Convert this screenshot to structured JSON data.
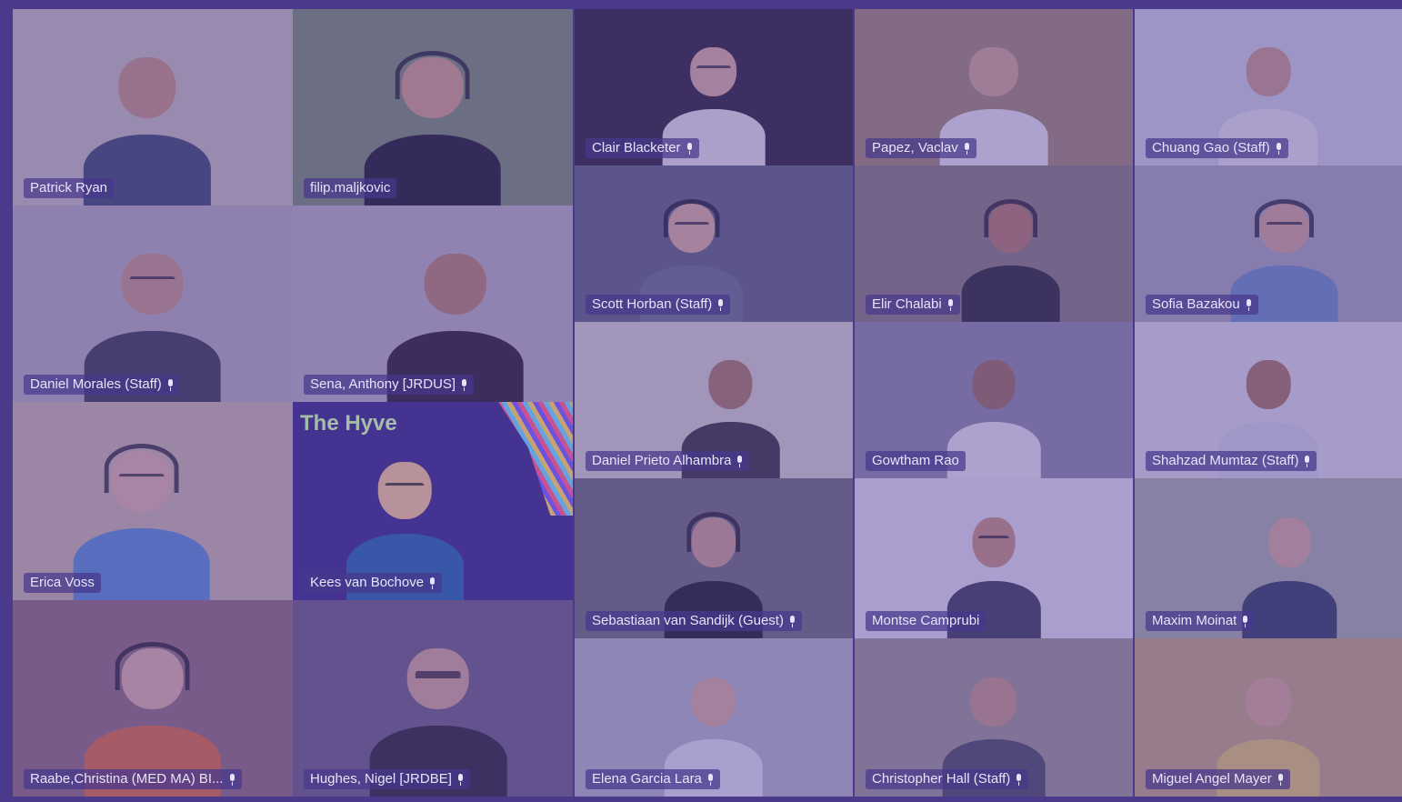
{
  "meeting": {
    "participants": [
      {
        "name": "Patrick Ryan",
        "mic": false,
        "bg": "#c9c2b5",
        "skin": "#c7957a",
        "shirt": "#3c4b66"
      },
      {
        "name": "filip.maljkovic",
        "mic": false,
        "bg": "#7a8f6c",
        "skin": "#d5a183",
        "shirt": "#1c1c24",
        "headset": true
      },
      {
        "name": "Clair Blacketer",
        "mic": true,
        "bg": "#2a2430",
        "skin": "#d9b09a",
        "shirt": "#e8e4e4",
        "glasses": true
      },
      {
        "name": "Papez, Vaclav",
        "mic": true,
        "bg": "#a38a6f",
        "skin": "#d2a98c",
        "shirt": "#e9e9e9"
      },
      {
        "name": "Chuang Gao (Staff)",
        "mic": true,
        "bg": "#cfd3db",
        "skin": "#c99c83",
        "shirt": "#e6e6e6"
      },
      {
        "name": "Scott Horban (Staff)",
        "mic": true,
        "bg": "#5d6479",
        "skin": "#dcb196",
        "shirt": "#6a7385",
        "headset": true,
        "glasses": true
      },
      {
        "name": "Elir Chalabi",
        "mic": true,
        "bg": "#8a7e74",
        "skin": "#b47c63",
        "shirt": "#2a2a30",
        "headset": true
      },
      {
        "name": "Sofia Bazakou",
        "mic": true,
        "bg": "#a9a7b4",
        "skin": "#d4a893",
        "shirt": "#6b8fbf",
        "headset": true,
        "glasses": true
      },
      {
        "name": "Daniel Morales (Staff)",
        "mic": true,
        "bg": "#b5b0b6",
        "skin": "#c99a80",
        "shirt": "#3a3d4a",
        "glasses": true
      },
      {
        "name": "Sena, Anthony [JRDUS]",
        "mic": true,
        "bg": "#b8b3bb",
        "skin": "#b88668",
        "shirt": "#2a2028"
      },
      {
        "name": "Daniel Prieto Alhambra",
        "mic": true,
        "bg": "#d8d2c8",
        "skin": "#a87b5f",
        "shirt": "#3a3438"
      },
      {
        "name": "Gowtham Rao",
        "mic": false,
        "bg": "#8d8ba0",
        "skin": "#9a6e55",
        "shirt": "#e8e8e8"
      },
      {
        "name": "Shahzad Mumtaz (Staff)",
        "mic": true,
        "bg": "#e1dde2",
        "skin": "#a8785c",
        "shirt": "#d2d6e0"
      },
      {
        "name": "Erica Voss",
        "mic": false,
        "bg": "#cdb8a6",
        "skin": "#e2b7a3",
        "shirt": "#5a8fd0",
        "headset": true,
        "glasses": true
      },
      {
        "name": "Kees van Bochove",
        "mic": true,
        "bg": "#3f2f8a",
        "skin": "#d9ae96",
        "shirt": "#2f5fa8",
        "glasses": true,
        "brand": "The Hyve"
      },
      {
        "name": "Sebastiaan van Sandijk (Guest)",
        "mic": true,
        "bg": "#6f6e72",
        "skin": "#caa08a",
        "shirt": "#1e1e24",
        "headset": true
      },
      {
        "name": "Montse Camprubi",
        "mic": false,
        "bg": "#e4e2e8",
        "skin": "#c99377",
        "shirt": "#3b3f52",
        "glasses": true
      },
      {
        "name": "Maxim Moinat",
        "mic": true,
        "bg": "#a9b2a4",
        "skin": "#d8ad94",
        "shirt": "#32405a"
      },
      {
        "name": "Raabe,Christina (MED MA) BI...",
        "mic": true,
        "bg": "#8f6e73",
        "skin": "#e0b6a2",
        "shirt": "#e06e3a",
        "headset": true
      },
      {
        "name": "Hughes, Nigel [JRDBE]",
        "mic": true,
        "bg": "#6d5f7d",
        "skin": "#d3aa93",
        "shirt": "#2a2730",
        "glasses": true
      },
      {
        "name": "Elena Garcia Lara",
        "mic": true,
        "bg": "#b7b8c4",
        "skin": "#d9b29c",
        "shirt": "#e6e6ec"
      },
      {
        "name": "Christopher Hall (Staff)",
        "mic": true,
        "bg": "#9f968e",
        "skin": "#c79a81",
        "shirt": "#4a4e5c"
      },
      {
        "name": "Miguel Angel Mayer",
        "mic": true,
        "bg": "#c4a777",
        "skin": "#d8ab8f",
        "shirt": "#e4c66a"
      }
    ]
  }
}
